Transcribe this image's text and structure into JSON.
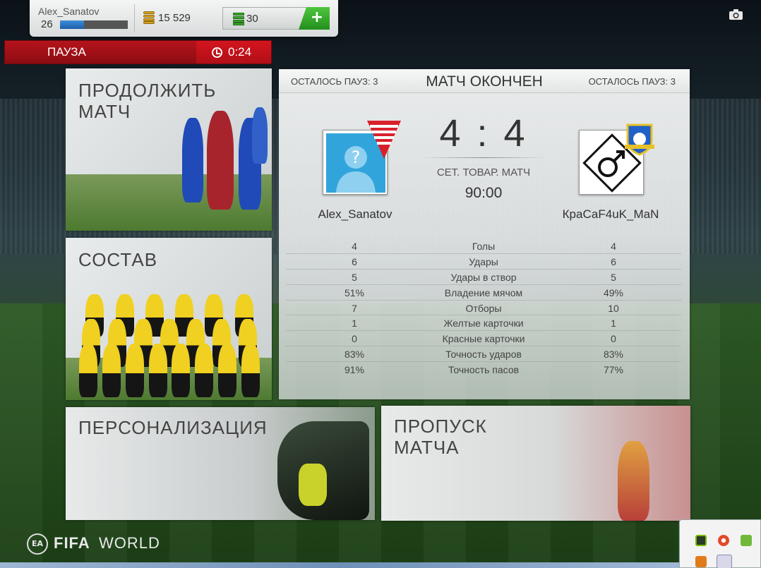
{
  "user": {
    "name": "Alex_Sanatov",
    "level": "26",
    "xp_progress": 0.35
  },
  "currency": {
    "coins": "15 529",
    "points": "30",
    "add_label": "+"
  },
  "pause": {
    "label": "ПАУЗА",
    "timer": "0:24"
  },
  "tiles": {
    "continue": "ПРОДОЛЖИТЬ\nМАТЧ",
    "squad": "СОСТАВ",
    "customize": "ПЕРСОНАЛИЗАЦИЯ",
    "skip": "ПРОПУСК\nМАТЧА"
  },
  "match": {
    "pauses_left_home": "ОСТАЛОСЬ ПАУЗ: 3",
    "pauses_left_away": "ОСТАЛОСЬ ПАУЗ: 3",
    "status": "МАТЧ ОКОНЧЕН",
    "score": "4 : 4",
    "type": "СЕТ. ТОВАР. МАТЧ",
    "time": "90:00",
    "home_team": "Alex_Sanatov",
    "away_team": "КраСаF4uK_MaN"
  },
  "stats": [
    {
      "home": "4",
      "label": "Голы",
      "away": "4"
    },
    {
      "home": "6",
      "label": "Удары",
      "away": "6"
    },
    {
      "home": "5",
      "label": "Удары в створ",
      "away": "5"
    },
    {
      "home": "51%",
      "label": "Владение мячом",
      "away": "49%"
    },
    {
      "home": "7",
      "label": "Отборы",
      "away": "10"
    },
    {
      "home": "1",
      "label": "Желтые карточки",
      "away": "1"
    },
    {
      "home": "0",
      "label": "Красные карточки",
      "away": "0"
    },
    {
      "home": "83%",
      "label": "Точность ударов",
      "away": "83%"
    },
    {
      "home": "91%",
      "label": "Точность пасов",
      "away": "77%"
    }
  ],
  "brand": {
    "ea": "EA",
    "fifa": "FIFA",
    "world": "WORLD"
  },
  "icons": [
    "camera-icon",
    "clock-icon",
    "coins-icon",
    "fifa-points-icon",
    "unknown-avatar-icon",
    "male-symbol-icon"
  ],
  "colors": {
    "pause_red": "#b5131b",
    "add_green": "#3aa82e",
    "avatar_blue": "#31a4dc"
  }
}
